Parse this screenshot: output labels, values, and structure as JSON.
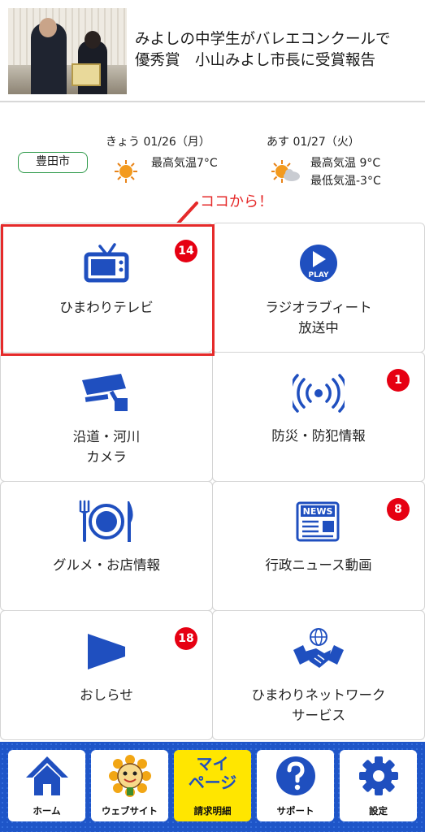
{
  "news": {
    "headline": "みよしの中学生がバレエコンクールで\n優秀賞　小山みよし市長に受賞報告"
  },
  "weather": {
    "city": "豊田市",
    "today": {
      "label": "きょう 01/26（月）",
      "high": "最高気温7°C",
      "icon": "sun-icon"
    },
    "tomorrow": {
      "label": "あす 01/27（火）",
      "high": "最高気温 9°C",
      "low": "最低気温-3°C",
      "icon": "sun-cloud-icon"
    }
  },
  "annotation": "ココから！",
  "tiles": [
    {
      "label": "ひまわりテレビ",
      "badge": "14",
      "icon": "tv-icon"
    },
    {
      "label": "ラジオラブィート\n放送中",
      "badge": "",
      "icon": "play-icon"
    },
    {
      "label": "沿道・河川\nカメラ",
      "badge": "",
      "icon": "camera-icon"
    },
    {
      "label": "防災・防犯情報",
      "badge": "1",
      "icon": "broadcast-icon"
    },
    {
      "label": "グルメ・お店情報",
      "badge": "",
      "icon": "dining-icon"
    },
    {
      "label": "行政ニュース動画",
      "badge": "8",
      "icon": "news-icon"
    },
    {
      "label": "おしらせ",
      "badge": "18",
      "icon": "megaphone-icon"
    },
    {
      "label": "ひまわりネットワーク\nサービス",
      "badge": "",
      "icon": "handshake-icon"
    }
  ],
  "nav": {
    "home": "ホーム",
    "website": "ウェブサイト",
    "mypage_big": "マイ\nページ",
    "mypage_sub": "請求明細",
    "support": "サポート",
    "settings": "設定",
    "play_text": "PLAY",
    "news_text": "NEWS"
  },
  "colors": {
    "accent": "#1f4fbf",
    "badge": "#e60012",
    "nav_bg": "#1e55c8",
    "mypage": "#ffe600",
    "annotation": "#e52a2a"
  }
}
